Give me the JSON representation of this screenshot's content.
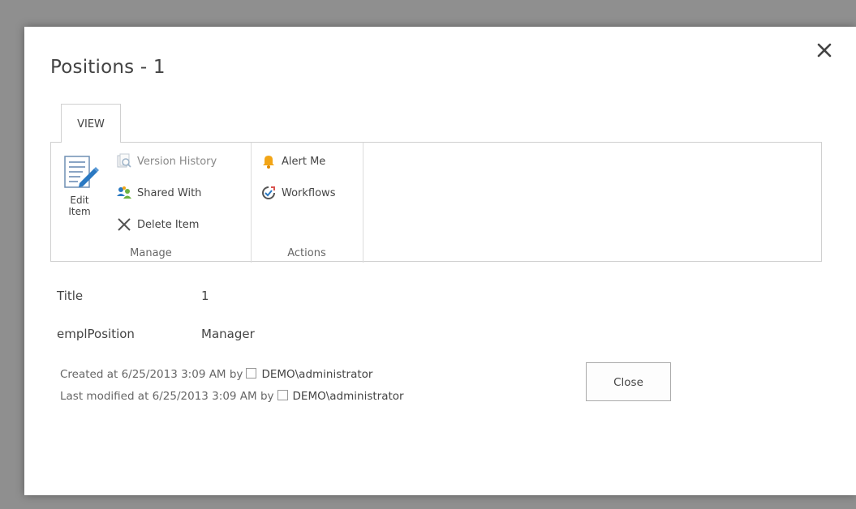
{
  "dialog": {
    "title": "Positions - 1",
    "close_icon": "close-icon"
  },
  "ribbon": {
    "tab_label": "VIEW",
    "groups": {
      "manage": {
        "label": "Manage",
        "edit_item_line1": "Edit",
        "edit_item_line2": "Item",
        "version_history": "Version History",
        "shared_with": "Shared With",
        "delete_item": "Delete Item"
      },
      "actions": {
        "label": "Actions",
        "alert_me": "Alert Me",
        "workflows": "Workflows"
      }
    }
  },
  "fields": [
    {
      "label": "Title",
      "value": "1"
    },
    {
      "label": "emplPosition",
      "value": "Manager"
    }
  ],
  "meta": {
    "created_prefix": "Created at 6/25/2013 3:09 AM  by",
    "created_user": "DEMO\\administrator",
    "modified_prefix": "Last modified at 6/25/2013 3:09 AM  by",
    "modified_user": "DEMO\\administrator"
  },
  "buttons": {
    "close_label": "Close"
  },
  "colors": {
    "overlay": "#8f8f8f",
    "border": "#d0d0d0",
    "text": "#444444",
    "alert_icon": "#f2a516",
    "edit_icon_blue": "#2b79c2"
  }
}
